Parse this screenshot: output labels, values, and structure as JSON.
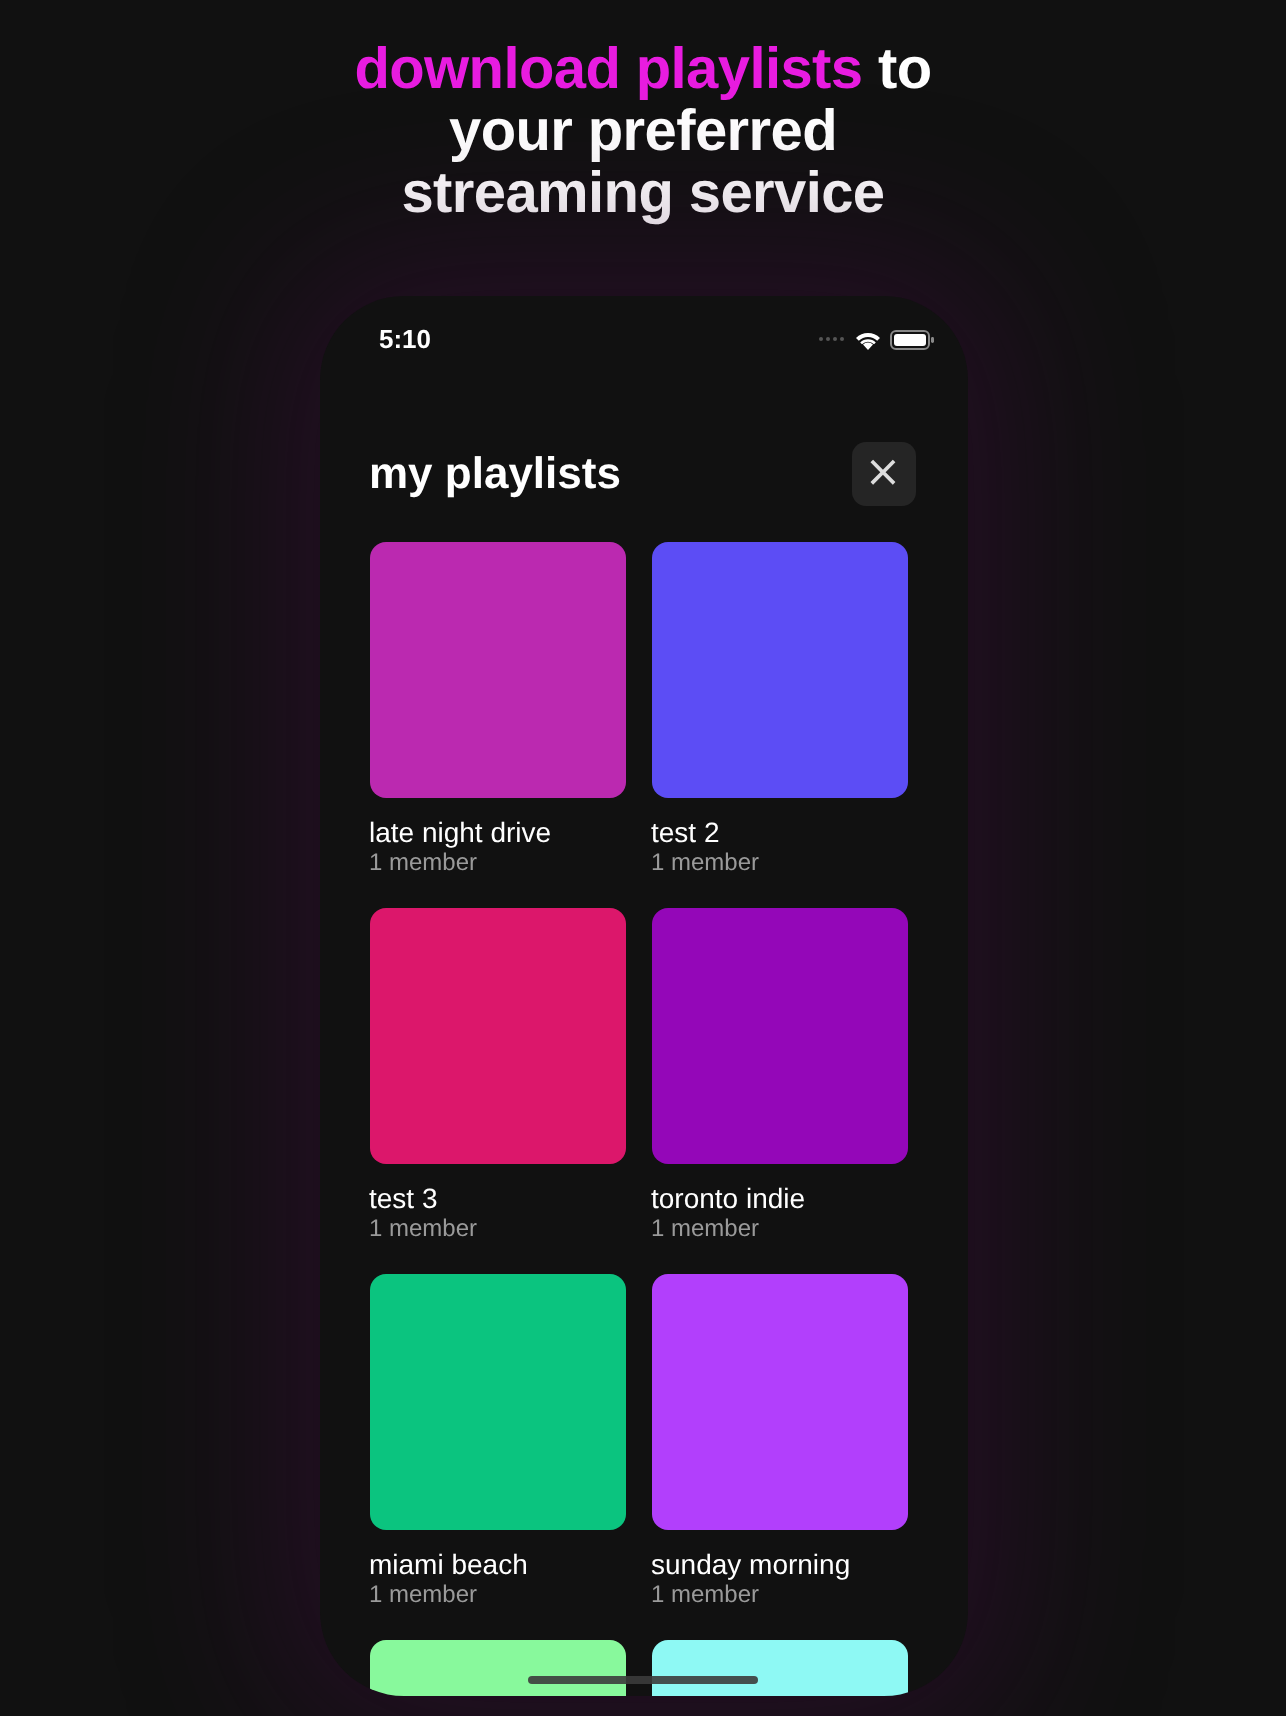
{
  "headline": {
    "accent": "download playlists",
    "rest": "to your preferred streaming service"
  },
  "status_bar": {
    "time": "5:10"
  },
  "screen": {
    "title": "my playlists",
    "close_button": "×"
  },
  "playlists": [
    {
      "name": "late night drive",
      "members": "1 member",
      "color": "#bb29b0"
    },
    {
      "name": "test 2",
      "members": "1 member",
      "color": "#5c4df5"
    },
    {
      "name": "test 3",
      "members": "1 member",
      "color": "#dc176b"
    },
    {
      "name": "toronto indie",
      "members": "1 member",
      "color": "#9407b8"
    },
    {
      "name": "miami beach",
      "members": "1 member",
      "color": "#0bc47f"
    },
    {
      "name": "sunday morning",
      "members": "1 member",
      "color": "#b23ffc"
    },
    {
      "color": "#88f99c"
    },
    {
      "color": "#8ef9f4"
    }
  ]
}
